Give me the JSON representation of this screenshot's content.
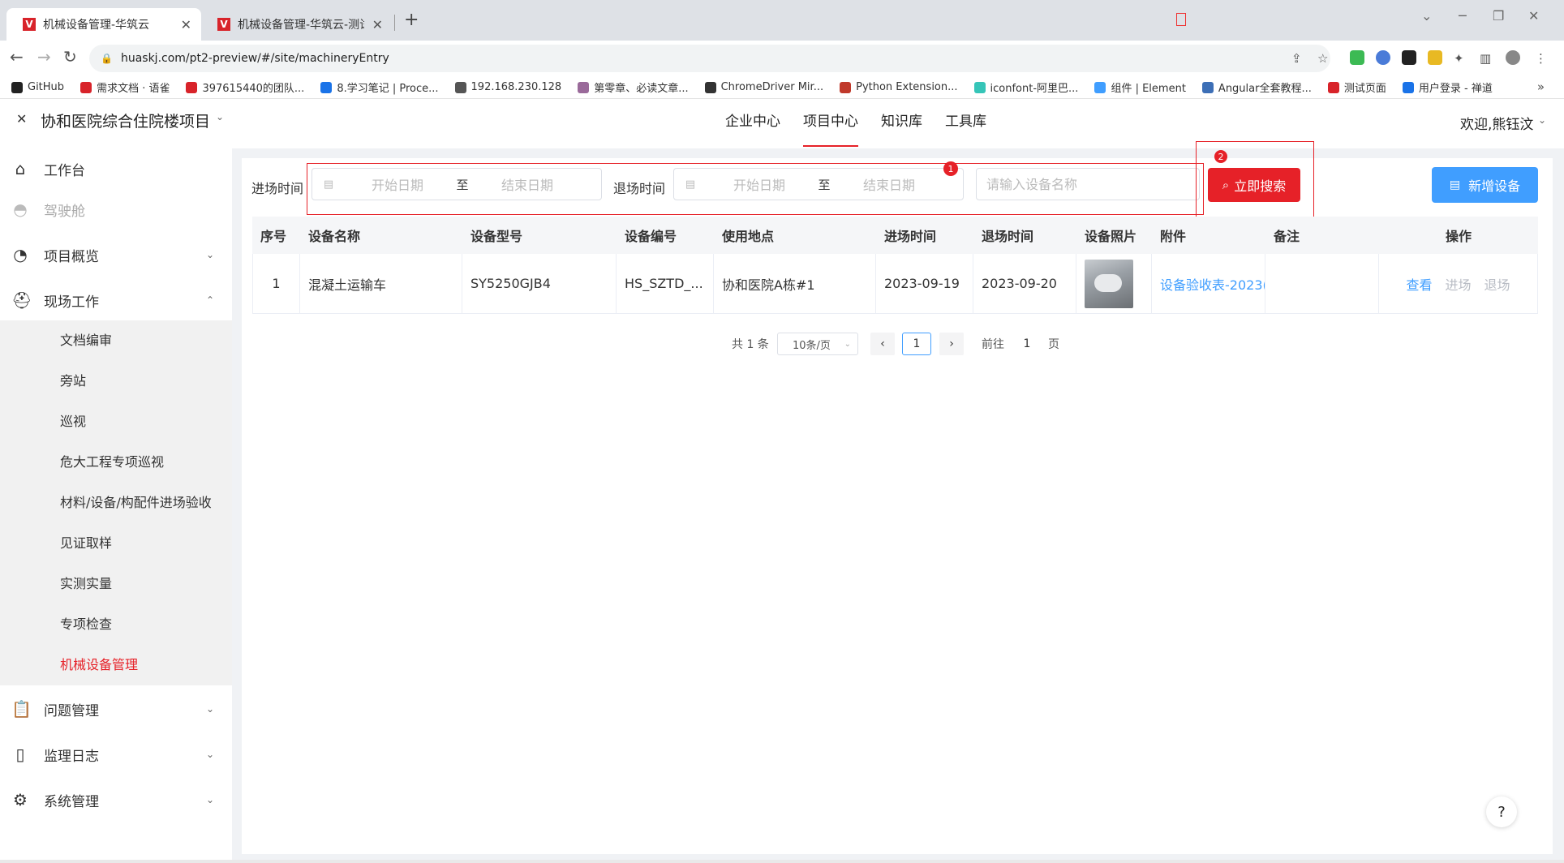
{
  "browser": {
    "tabs": [
      {
        "title": "机械设备管理-华筑云",
        "active": true
      },
      {
        "title": "机械设备管理-华筑云-测试",
        "active": false
      }
    ],
    "url": "huaskj.com/pt2-preview/#/site/machineryEntry",
    "bookmarks": [
      {
        "label": "GitHub",
        "icon": "github-icon",
        "color": "#222222"
      },
      {
        "label": "需求文档 · 语雀",
        "icon": "huazhu-icon",
        "color": "#d8232a"
      },
      {
        "label": "397615440的团队...",
        "icon": "cc-icon",
        "color": "#d8232a"
      },
      {
        "label": "8.学习笔记 | Proce...",
        "icon": "on-icon",
        "color": "#1a73e8"
      },
      {
        "label": "192.168.230.128",
        "icon": "globe-icon",
        "color": "#555555"
      },
      {
        "label": "第零章、必读文章...",
        "icon": "circle-icon",
        "color": "#9a6a9a"
      },
      {
        "label": "ChromeDriver Mir...",
        "icon": "chrome-icon",
        "color": "#333333"
      },
      {
        "label": "Python Extension...",
        "icon": "python-icon",
        "color": "#c0392b"
      },
      {
        "label": "iconfont-阿里巴...",
        "icon": "iconfont-icon",
        "color": "#36c5b8"
      },
      {
        "label": "组件 | Element",
        "icon": "element-icon",
        "color": "#409eff"
      },
      {
        "label": "Angular全套教程...",
        "icon": "angular-icon",
        "color": "#3d6fb6"
      },
      {
        "label": "测试页面",
        "icon": "huazhu-icon",
        "color": "#d8232a"
      },
      {
        "label": "用户登录 - 禅道",
        "icon": "zentao-icon",
        "color": "#1a73e8"
      }
    ]
  },
  "header": {
    "project_title": "协和医院综合住院楼项目",
    "nav": [
      "企业中心",
      "项目中心",
      "知识库",
      "工具库"
    ],
    "active_nav": "项目中心",
    "welcome": "欢迎,熊钰汶"
  },
  "sidebar": {
    "items": [
      {
        "label": "工作台",
        "icon": "home-icon"
      },
      {
        "label": "驾驶舱",
        "icon": "dashboard-icon",
        "disabled": true
      },
      {
        "label": "项目概览",
        "icon": "pie-chart-icon"
      },
      {
        "label": "现场工作",
        "icon": "helmet-icon"
      }
    ],
    "sub_items": [
      "文档编审",
      "旁站",
      "巡视",
      "危大工程专项巡视",
      "材料/设备/构配件进场验收",
      "见证取样",
      "实测实量",
      "专项检查",
      "机械设备管理"
    ],
    "active_sub": "机械设备管理",
    "bottom_items": [
      {
        "label": "问题管理",
        "icon": "clipboard-icon"
      },
      {
        "label": "监理日志",
        "icon": "log-icon"
      },
      {
        "label": "系统管理",
        "icon": "settings-icon"
      }
    ]
  },
  "filters": {
    "entry_label": "进场时间",
    "exit_label": "退场时间",
    "start_placeholder": "开始日期",
    "end_placeholder": "结束日期",
    "range_sep": "至",
    "name_placeholder": "请输入设备名称",
    "search_label": "立即搜索",
    "add_label": "新增设备"
  },
  "annotations": {
    "box1": "1",
    "box2": "2"
  },
  "table": {
    "columns": [
      "序号",
      "设备名称",
      "设备型号",
      "设备编号",
      "使用地点",
      "进场时间",
      "退场时间",
      "设备照片",
      "附件",
      "备注",
      "操作"
    ],
    "rows": [
      {
        "index": "1",
        "name": "混凝土运输车",
        "model": "SY5250GJB4",
        "code": "HS_SZTD_...",
        "location": "协和医院A栋#1",
        "entry": "2023-09-19",
        "exit": "2023-09-20",
        "attachment": "设备验收表-2023(",
        "remark": "",
        "ops": [
          "查看",
          "进场",
          "退场"
        ]
      }
    ]
  },
  "pagination": {
    "total": "共 1 条",
    "page_size": "10条/页",
    "current": "1",
    "goto_prefix": "前往",
    "goto_value": "1",
    "goto_suffix": "页"
  },
  "colors": {
    "accent": "#e62128",
    "primary": "#409eff"
  }
}
